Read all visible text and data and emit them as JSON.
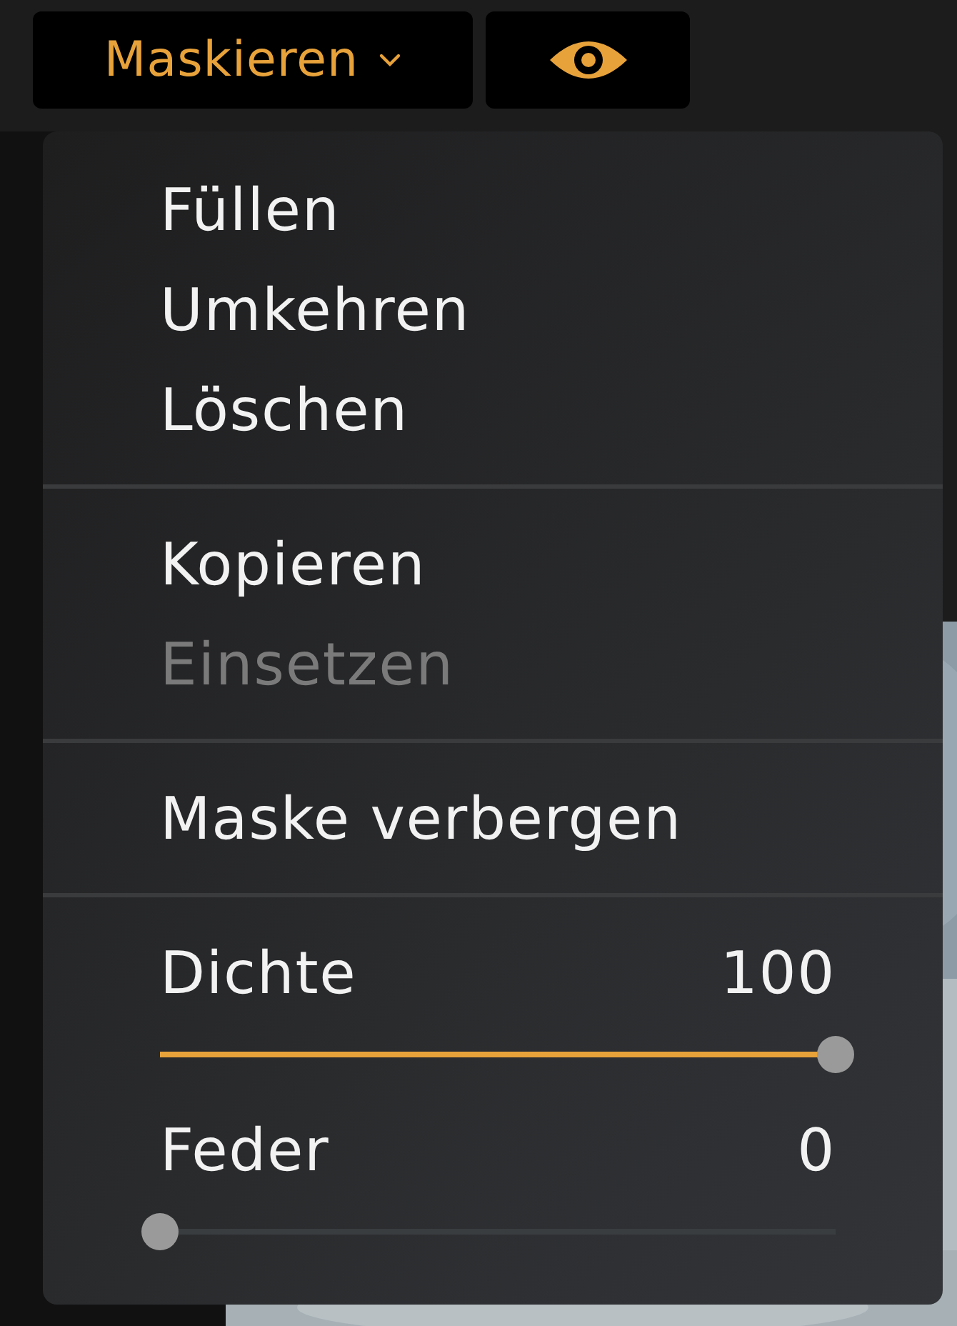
{
  "toolbar": {
    "mask_button": {
      "label": "Maskieren",
      "expanded": true
    }
  },
  "menu": {
    "sections": [
      {
        "items": [
          {
            "label": "Füllen",
            "disabled": false
          },
          {
            "label": "Umkehren",
            "disabled": false
          },
          {
            "label": "Löschen",
            "disabled": false
          }
        ]
      },
      {
        "items": [
          {
            "label": "Kopieren",
            "disabled": false
          },
          {
            "label": "Einsetzen",
            "disabled": true
          }
        ]
      },
      {
        "items": [
          {
            "label": "Maske verbergen",
            "disabled": false
          }
        ]
      }
    ],
    "sliders": [
      {
        "label": "Dichte",
        "value": "100",
        "level": 1
      },
      {
        "label": "Feder",
        "value": "0",
        "level": 0
      }
    ]
  }
}
